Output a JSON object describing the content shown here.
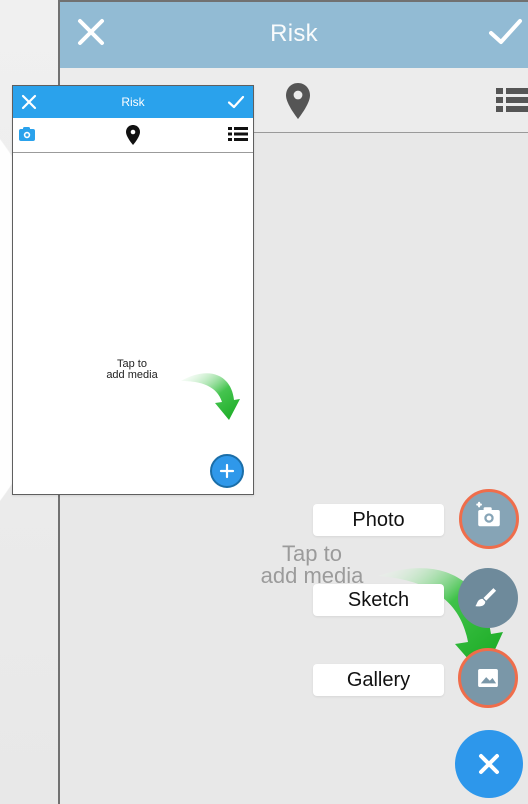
{
  "background": {
    "device_title": "Risk"
  },
  "tutorial_card": {
    "title": "Risk",
    "tip": "Tap to\nadd media"
  },
  "main_tip": {
    "text": "Tap to\nadd media"
  },
  "media_menu": {
    "photo_label": "Photo",
    "sketch_label": "Sketch",
    "gallery_label": "Gallery"
  },
  "icons": {
    "device_close": "close-icon",
    "device_check": "check-icon",
    "device_location": "location-pin-icon",
    "device_list": "list-icon",
    "card_close": "close-icon",
    "card_check": "check-icon",
    "card_camera": "camera-icon",
    "card_location": "location-pin-icon",
    "card_list": "list-icon",
    "card_add": "plus-icon",
    "photo_action": "camera-add-icon",
    "sketch_action": "brush-icon",
    "gallery_action": "image-icon",
    "close_menu": "close-icon"
  },
  "colors": {
    "device_header": "#92bbd4",
    "card_header": "#2aa2ec",
    "fab_blue": "#2d97eb",
    "highlight_orange": "#ef6d4b",
    "arrow_green": "#22b532"
  }
}
